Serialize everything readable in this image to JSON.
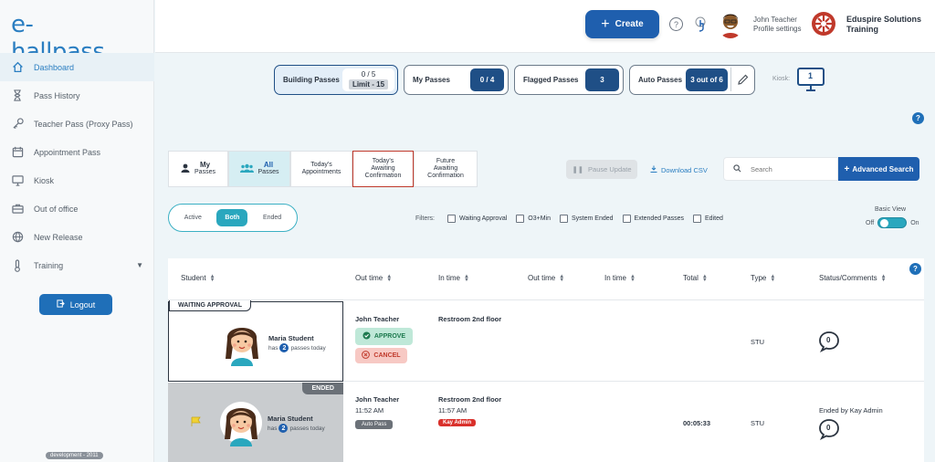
{
  "sidebar": {
    "logo": "e-hallpass",
    "items": [
      {
        "label": "Dashboard",
        "icon": "home-icon"
      },
      {
        "label": "Pass History",
        "icon": "hourglass-icon"
      },
      {
        "label": "Teacher Pass (Proxy Pass)",
        "icon": "key-icon"
      },
      {
        "label": "Appointment Pass",
        "icon": "calendar-icon"
      },
      {
        "label": "Kiosk",
        "icon": "monitor-icon"
      },
      {
        "label": "Out of office",
        "icon": "briefcase-icon"
      },
      {
        "label": "New Release",
        "icon": "globe-icon"
      },
      {
        "label": "Training",
        "icon": "thermometer-icon"
      }
    ],
    "logout": "Logout",
    "env": "development - 2011"
  },
  "topbar": {
    "create": "Create",
    "help": "?",
    "user_name": "John Teacher",
    "user_sub": "Profile settings",
    "school_name": "Eduspire Solutions",
    "school_sub": "Training"
  },
  "counters": {
    "building_label": "Building Passes",
    "building_count": "0 / 5",
    "building_limit": "Limit - 15",
    "my_label": "My Passes",
    "my_count": "0 / 4",
    "flagged_label": "Flagged Passes",
    "flagged_count": "3",
    "auto_label": "Auto Passes",
    "auto_count": "3 out of 6",
    "kiosk_label": "Kiosk:",
    "kiosk_count": "1"
  },
  "tabs": {
    "my": [
      "My",
      "Passes"
    ],
    "all": [
      "All",
      "Passes"
    ],
    "today_appt": [
      "Today's",
      "Appointments"
    ],
    "today_await": [
      "Today's",
      "Awaiting",
      "Confirmation"
    ],
    "future_await": [
      "Future",
      "Awaiting",
      "Confirmation"
    ]
  },
  "toolbar": {
    "pause": "Pause Update",
    "download": "Download CSV",
    "search_placeholder": "Search",
    "advanced": "Advanced Search"
  },
  "filter_row": {
    "segments": [
      "Active",
      "Both",
      "Ended"
    ],
    "selected": "Both",
    "filters_label": "Filters:",
    "checkboxes": [
      "Waiting Approval",
      "O3+Min",
      "System Ended",
      "Extended Passes",
      "Edited"
    ],
    "basic_view": "Basic View",
    "off": "Off",
    "on": "On"
  },
  "table": {
    "headers": [
      "Student",
      "Out time",
      "In time",
      "Out time",
      "In time",
      "Total",
      "Type",
      "Status/Comments"
    ],
    "rows": [
      {
        "tag": "WAITING APPROVAL",
        "student": "Maria Student",
        "passes_prefix": "has",
        "pass_count": "2",
        "passes_suffix": "passes today",
        "out_teacher": "John Teacher",
        "in_location": "Restroom 2nd floor",
        "approve": "APPROVE",
        "cancel": "CANCEL",
        "type": "STU",
        "comment_count": "0"
      },
      {
        "tag": "ENDED",
        "student": "Maria Student",
        "passes_prefix": "has",
        "pass_count": "2",
        "passes_suffix": "passes today",
        "out_teacher": "John Teacher",
        "out_time": "11:52 AM",
        "out_badge": "Auto Pass",
        "in_location": "Restroom 2nd floor",
        "in_time": "11:57 AM",
        "in_badge": "Kay Admin",
        "total": "00:05:33",
        "type": "STU",
        "status": "Ended by Kay Admin",
        "comment_count": "0"
      }
    ]
  },
  "colors": {
    "primary": "#1f5fae",
    "accent": "#2aa7be",
    "danger": "#d9302b",
    "success": "#1e7a4f"
  }
}
